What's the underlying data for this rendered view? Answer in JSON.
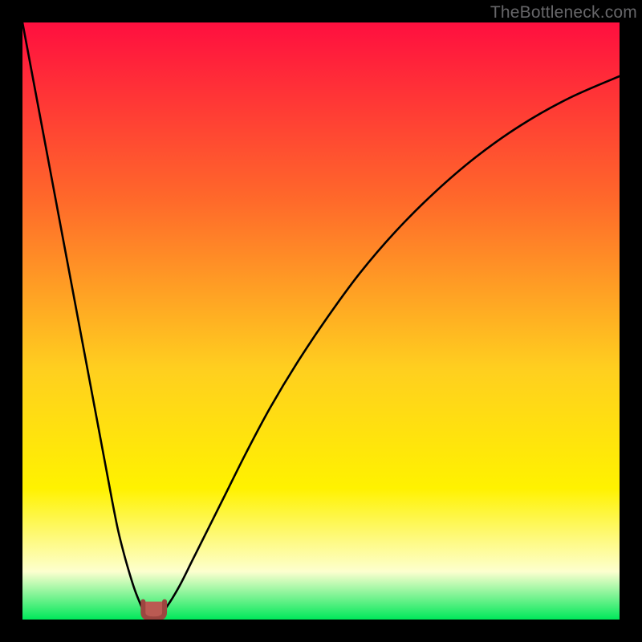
{
  "watermark": "TheBottleneck.com",
  "colors": {
    "frame": "#000000",
    "gradient_top": "#ff0f3f",
    "gradient_mid1": "#ff6a2a",
    "gradient_mid2": "#ffcf1f",
    "gradient_mid3": "#fff200",
    "gradient_pale": "#fdffcf",
    "gradient_bottom": "#00e85a",
    "curve": "#000000",
    "marker_fill": "#bb5a52",
    "marker_stroke": "#9c4640"
  },
  "chart_data": {
    "type": "line",
    "title": "",
    "xlabel": "",
    "ylabel": "",
    "xlim": [
      0,
      100
    ],
    "ylim": [
      0,
      100
    ],
    "series": [
      {
        "name": "bottleneck-curve-left",
        "x": [
          0.0,
          1.5,
          3.0,
          4.5,
          6.0,
          7.5,
          9.0,
          10.5,
          12.0,
          13.5,
          15.0,
          16.0,
          17.0,
          18.0,
          18.8,
          19.5,
          20.1,
          20.6,
          21.0
        ],
        "y": [
          100,
          92,
          84,
          76,
          68,
          60,
          52,
          44,
          36,
          28,
          20,
          15,
          11,
          7.5,
          5.0,
          3.2,
          1.8,
          0.9,
          0.3
        ]
      },
      {
        "name": "bottleneck-curve-right",
        "x": [
          22.8,
          23.3,
          24.0,
          25.0,
          26.5,
          28.5,
          31.0,
          34.0,
          37.5,
          41.5,
          46.0,
          51.0,
          56.5,
          62.5,
          69.0,
          76.0,
          83.5,
          91.5,
          100.0
        ],
        "y": [
          0.3,
          0.9,
          1.9,
          3.4,
          6.0,
          10.0,
          15.0,
          21.0,
          28.0,
          35.5,
          43.0,
          50.5,
          58.0,
          65.0,
          71.5,
          77.5,
          82.8,
          87.3,
          91.0
        ]
      }
    ],
    "vertex": {
      "x_center": 22.0,
      "x_halfwidth": 1.8,
      "y_bottom": 0.1,
      "y_top": 3.0
    },
    "legend": [],
    "annotations": []
  }
}
